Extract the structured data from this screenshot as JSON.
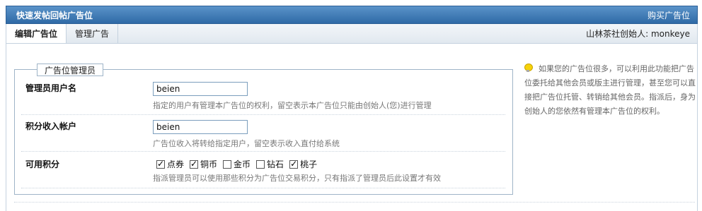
{
  "header": {
    "title": "快速发帖回帖广告位",
    "buy_link": "购买广告位"
  },
  "tabs": [
    {
      "label": "编辑广告位",
      "active": true
    },
    {
      "label": "管理广告",
      "active": false
    }
  ],
  "founder_text": "山林茶社创始人: monkeye",
  "fieldset": {
    "legend": "广告位管理员",
    "rows": [
      {
        "label": "管理员用户名",
        "value": "beien",
        "hint": "指定的用户有管理本广告位的权利，留空表示本广告位只能由创始人(您)进行管理"
      },
      {
        "label": "积分收入帐户",
        "value": "beien",
        "hint": "广告位收入将转给指定用户，留空表示收入直付给系统"
      }
    ],
    "points": {
      "label": "可用积分",
      "options": [
        {
          "label": "点券",
          "checked": true
        },
        {
          "label": "铜币",
          "checked": true
        },
        {
          "label": "金币",
          "checked": false
        },
        {
          "label": "钻石",
          "checked": false
        },
        {
          "label": "桃子",
          "checked": true
        }
      ],
      "hint": "指派管理员可以使用那些积分为广告位交易积分，只有指派了管理员后此设置才有效"
    }
  },
  "sidenote": "如果您的广告位很多，可以利用此功能把广告位委托给其他会员或版主进行管理，甚至您可以直接把广告位托管、转销给其他会员。指派后，身为创始人的您依然有管理本广告位的权利。",
  "colors": {
    "title_bar": "#3f7bb7",
    "tab_bar": "#e8eef4",
    "border": "#9fb4c8"
  }
}
